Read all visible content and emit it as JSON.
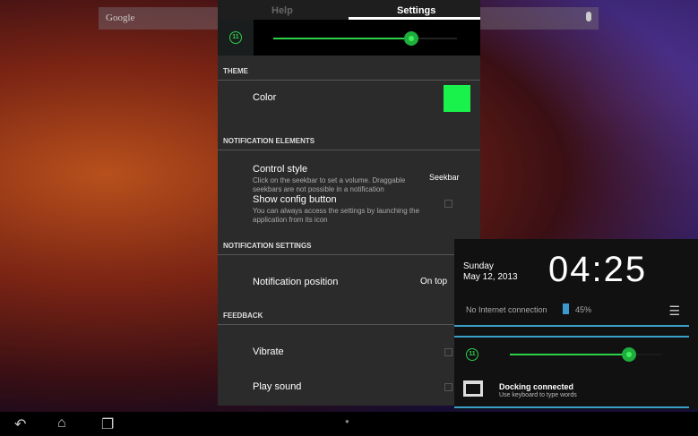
{
  "search": {
    "placeholder": "Google"
  },
  "tabs": [
    {
      "label": "Help"
    },
    {
      "label": "Settings"
    }
  ],
  "volume": {
    "level_badge": "11",
    "value_fraction": 0.75
  },
  "sections": {
    "theme": "THEME",
    "elements": "NOTIFICATION ELEMENTS",
    "settings": "NOTIFICATION SETTINGS",
    "feedback": "FEEDBACK"
  },
  "settings": {
    "color_label": "Color",
    "color_value": "#19f24a",
    "control_style": {
      "title": "Control style",
      "desc": "Click on the seekbar to set a volume. Draggable seekbars are not possible in a notification",
      "value": "Seekbar"
    },
    "config_button": {
      "title": "Show config button",
      "desc": "You can always access the settings by launching the application from its icon"
    },
    "position": {
      "title": "Notification position",
      "value": "On top"
    },
    "vibrate": "Vibrate",
    "sound": "Play sound"
  },
  "notification": {
    "day": "Sunday",
    "date": "May 12, 2013",
    "time": "04:25",
    "network": "No Internet connection",
    "battery": "45%",
    "volume_badge": "11",
    "volume_fraction": 0.78,
    "dock_title": "Docking connected",
    "dock_desc": "Use keyboard to type words"
  },
  "colors": {
    "accent": "#2ed04a",
    "blue": "#3aa0c8"
  }
}
